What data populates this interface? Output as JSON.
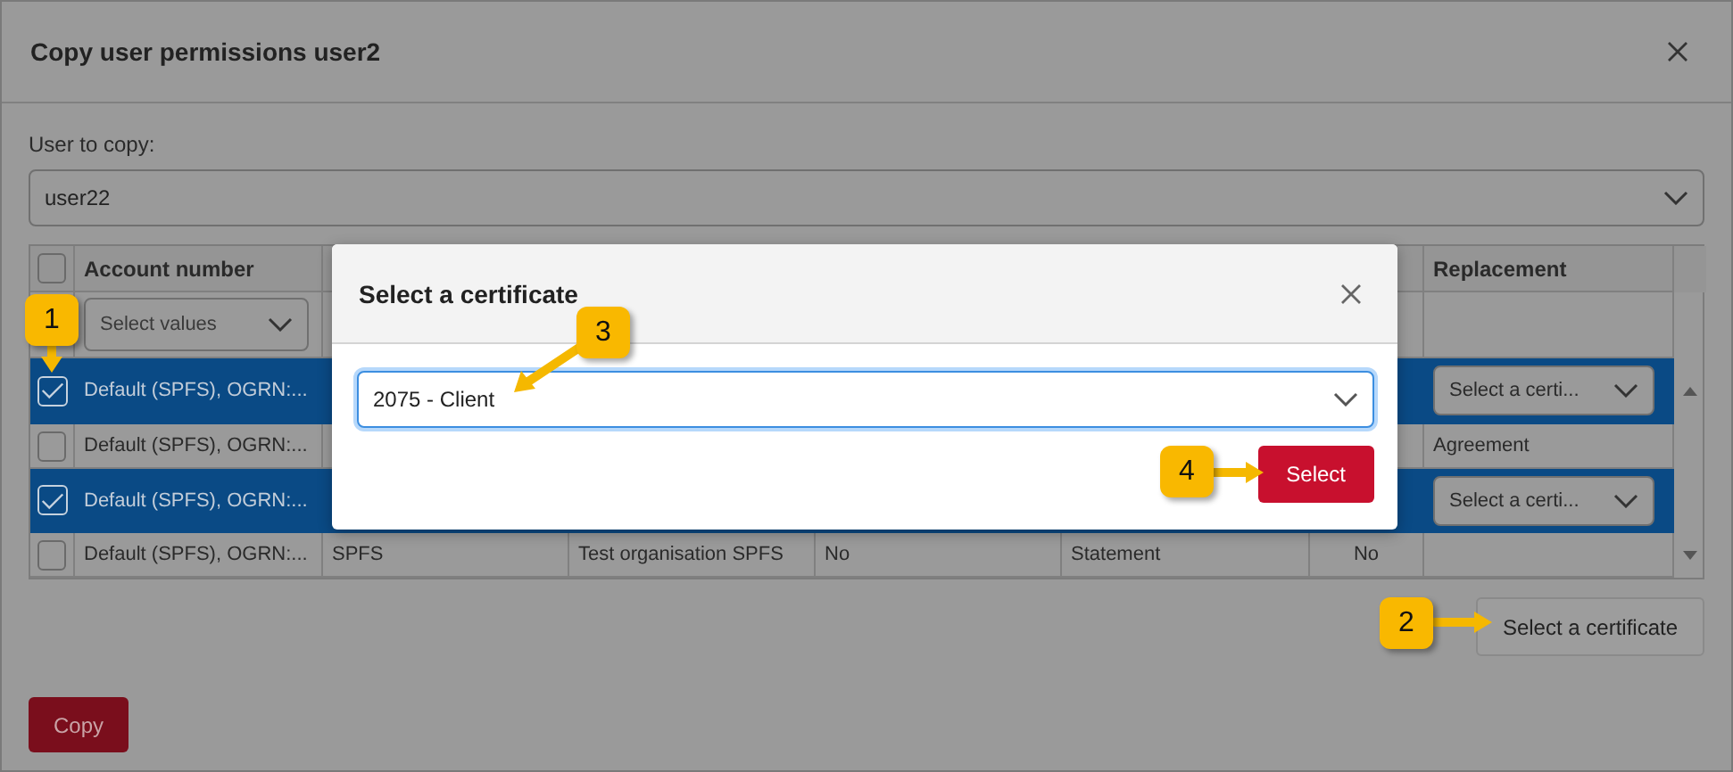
{
  "dialog": {
    "title": "Copy user permissions user2",
    "user_label": "User to copy:",
    "user_value": "user22"
  },
  "table": {
    "header_checked": false,
    "account_heading": "Account number",
    "replacement_heading": "Replacement",
    "filter_placeholder": "Select values",
    "rows": [
      {
        "selected": true,
        "checked": true,
        "account": "Default (SPFS), OGRN:...",
        "replacement": {
          "kind": "select",
          "text": "Select a certi..."
        }
      },
      {
        "selected": false,
        "checked": false,
        "account": "Default (SPFS), OGRN:...",
        "replacement": {
          "kind": "text",
          "text": "Agreement"
        }
      },
      {
        "selected": true,
        "checked": true,
        "account": "Default (SPFS), OGRN:...",
        "replacement": {
          "kind": "select",
          "text": "Select a certi..."
        }
      },
      {
        "selected": false,
        "checked": false,
        "account": "Default (SPFS), OGRN:...",
        "cells": [
          "SPFS",
          "Test organisation SPFS",
          "No",
          "Statement",
          "No"
        ]
      }
    ]
  },
  "select_certificate_button": "Select a certificate",
  "copy_button": "Copy",
  "certificate_dialog": {
    "title": "Select a certificate",
    "value": "2075 - Client",
    "button": "Select"
  },
  "callouts": [
    {
      "number": "1"
    },
    {
      "number": "2"
    },
    {
      "number": "3"
    },
    {
      "number": "4"
    }
  ]
}
